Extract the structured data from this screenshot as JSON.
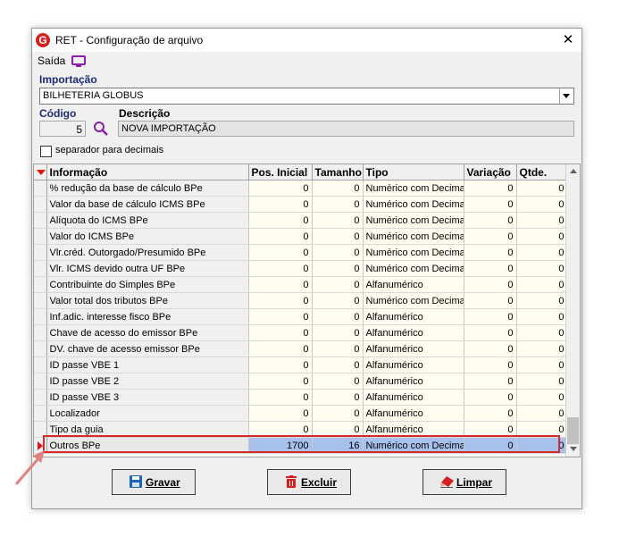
{
  "window": {
    "title": "RET - Configuração de arquivo",
    "logo_letter": "G",
    "close_glyph": "✕"
  },
  "menu": {
    "saida": "Saída"
  },
  "importacao": {
    "label": "Importação",
    "selected": "BILHETERIA GLOBUS"
  },
  "codigo": {
    "label": "Código",
    "value": "5"
  },
  "descricao": {
    "label": "Descrição",
    "value": "NOVA IMPORTAÇÃO"
  },
  "separador": {
    "label": "separador para decimais",
    "checked": false
  },
  "grid": {
    "headers": [
      "Informação",
      "Pos. Inicial",
      "Tamanho",
      "Tipo",
      "Variação",
      "Qtde."
    ],
    "rows": [
      [
        "% redução da base de cálculo BPe",
        "0",
        "0",
        "Numérico com Decimal",
        "0",
        "0"
      ],
      [
        "Valor da base de cálculo ICMS BPe",
        "0",
        "0",
        "Numérico com Decimal",
        "0",
        "0"
      ],
      [
        "Alíquota do ICMS BPe",
        "0",
        "0",
        "Numérico com Decimal",
        "0",
        "0"
      ],
      [
        "Valor do ICMS BPe",
        "0",
        "0",
        "Numérico com Decimal",
        "0",
        "0"
      ],
      [
        "Vlr.créd. Outorgado/Presumido BPe",
        "0",
        "0",
        "Numérico com Decimal",
        "0",
        "0"
      ],
      [
        "Vlr. ICMS devido outra UF BPe",
        "0",
        "0",
        "Numérico com Decimal",
        "0",
        "0"
      ],
      [
        "Contribuinte do Simples BPe",
        "0",
        "0",
        "Alfanumérico",
        "0",
        "0"
      ],
      [
        "Valor total dos tributos BPe",
        "0",
        "0",
        "Numérico com Decimal",
        "0",
        "0"
      ],
      [
        "Inf.adic. interesse fisco BPe",
        "0",
        "0",
        "Alfanumérico",
        "0",
        "0"
      ],
      [
        "Chave de acesso do emissor BPe",
        "0",
        "0",
        "Alfanumérico",
        "0",
        "0"
      ],
      [
        "DV. chave de acesso emissor BPe",
        "0",
        "0",
        "Alfanumérico",
        "0",
        "0"
      ],
      [
        "ID passe VBE 1",
        "0",
        "0",
        "Alfanumérico",
        "0",
        "0"
      ],
      [
        "ID passe VBE 2",
        "0",
        "0",
        "Alfanumérico",
        "0",
        "0"
      ],
      [
        "ID passe VBE 3",
        "0",
        "0",
        "Alfanumérico",
        "0",
        "0"
      ],
      [
        "Localizador",
        "0",
        "0",
        "Alfanumérico",
        "0",
        "0"
      ],
      [
        "Tipo da guia",
        "0",
        "0",
        "Alfanumérico",
        "0",
        "0"
      ],
      [
        "Outros BPe",
        "1700",
        "16",
        "Numérico com Decimal",
        "0",
        "0"
      ]
    ],
    "selected_row": 16
  },
  "buttons": {
    "gravar": "Gravar",
    "excluir": "Excluir",
    "limpar": "Limpar"
  },
  "colors": {
    "accent_red": "#d62b2b",
    "label_blue": "#1d2c74",
    "selection": "#a8c0ec",
    "monitor_purple": "#8a1ea8"
  }
}
